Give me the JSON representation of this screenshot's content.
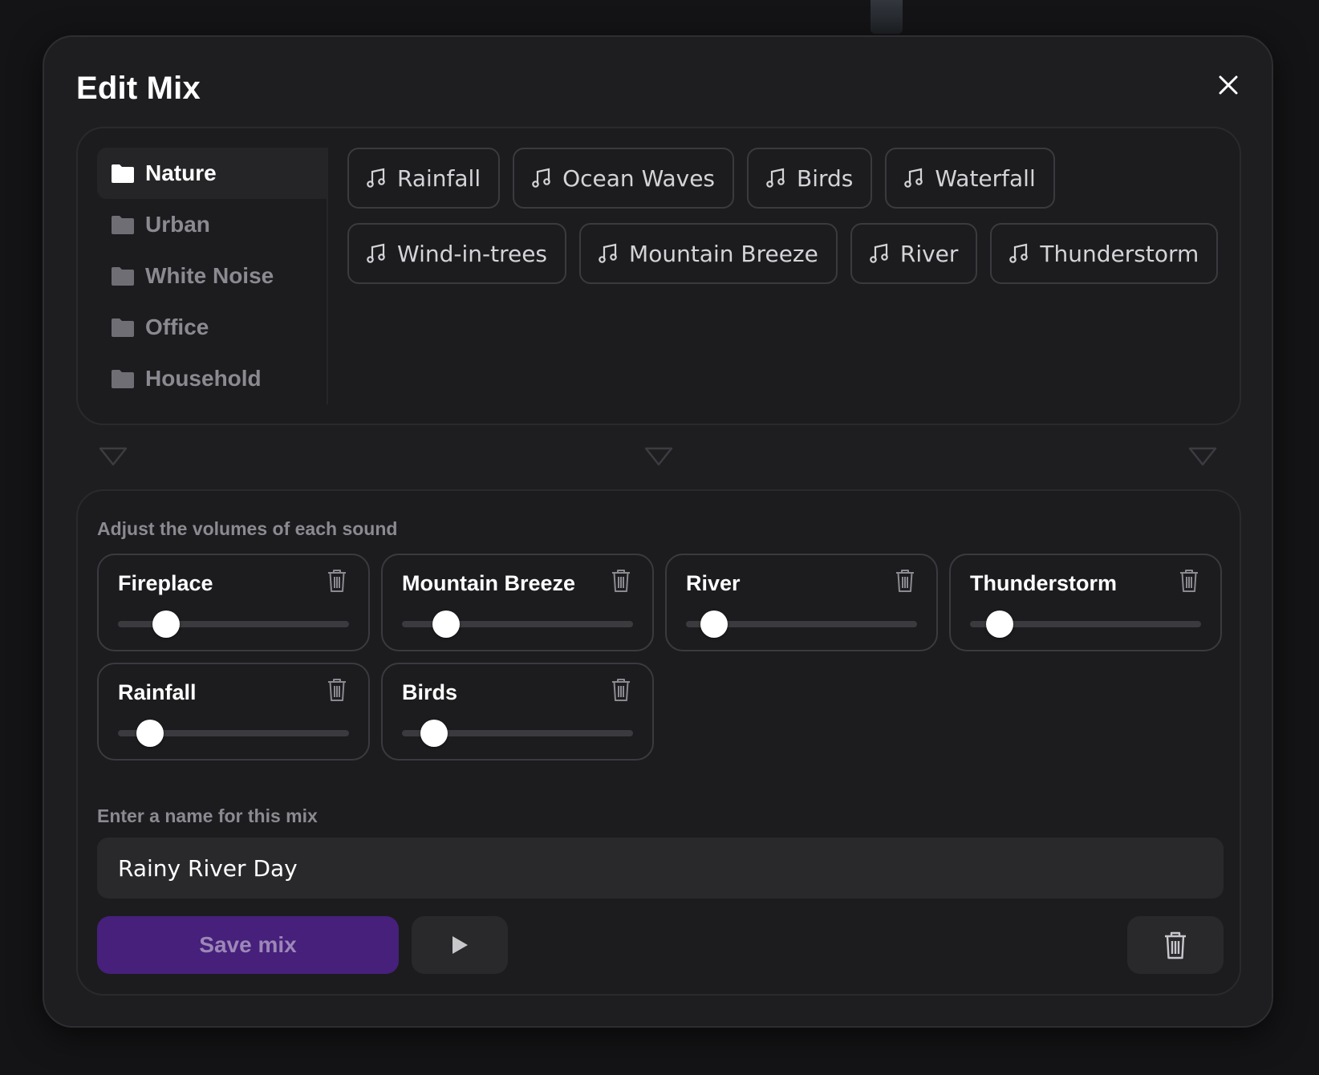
{
  "modal": {
    "title": "Edit Mix"
  },
  "categories": [
    {
      "label": "Nature",
      "active": true
    },
    {
      "label": "Urban",
      "active": false
    },
    {
      "label": "White Noise",
      "active": false
    },
    {
      "label": "Office",
      "active": false
    },
    {
      "label": "Household",
      "active": false
    }
  ],
  "sounds": [
    {
      "label": "Rainfall",
      "icon": "music-note-icon"
    },
    {
      "label": "Ocean Waves",
      "icon": "music-note-icon"
    },
    {
      "label": "Birds",
      "icon": "music-note-icon"
    },
    {
      "label": "Waterfall",
      "icon": "music-note-icon"
    },
    {
      "label": "Wind-in-trees",
      "icon": "music-note-icon"
    },
    {
      "label": "Mountain Breeze",
      "icon": "music-note-icon"
    },
    {
      "label": "River",
      "icon": "music-note-icon"
    },
    {
      "label": "Thunderstorm",
      "icon": "music-note-icon"
    }
  ],
  "volumes": {
    "label": "Adjust the volumes of each sound",
    "items": [
      {
        "name": "Fireplace",
        "level": 0.21
      },
      {
        "name": "Mountain Breeze",
        "level": 0.19
      },
      {
        "name": "River",
        "level": 0.12
      },
      {
        "name": "Thunderstorm",
        "level": 0.13
      },
      {
        "name": "Rainfall",
        "level": 0.14
      },
      {
        "name": "Birds",
        "level": 0.14
      }
    ]
  },
  "mix_name": {
    "label": "Enter a name for this mix",
    "value": "Rainy River Day"
  },
  "actions": {
    "save_label": "Save mix"
  },
  "colors": {
    "accent": "#46207a",
    "background": "#1e1e21"
  }
}
